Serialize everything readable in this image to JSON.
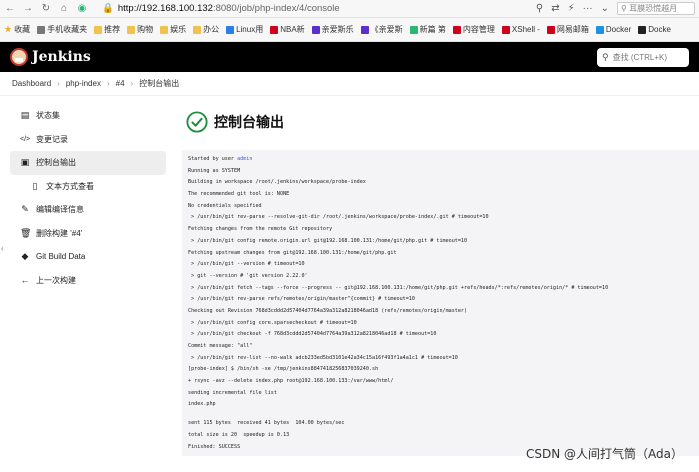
{
  "browser": {
    "url_host": "http://192.168.100.132",
    "url_path": ":8080/job/php-index/4/console",
    "search_placeholder": "耳膜恐慌越月",
    "bookmarks": [
      {
        "label": "收藏",
        "icon": "star-icon",
        "color": "#f5a623"
      },
      {
        "label": "手机收藏夹",
        "icon": "phone-icon",
        "color": "#777777"
      },
      {
        "label": "推荐",
        "icon": "folder-icon",
        "color": "#f2c14e"
      },
      {
        "label": "购物",
        "icon": "folder-icon",
        "color": "#f2c14e"
      },
      {
        "label": "娱乐",
        "icon": "folder-icon",
        "color": "#f2c14e"
      },
      {
        "label": "办公",
        "icon": "folder-icon",
        "color": "#f2c14e"
      },
      {
        "label": "Linux用",
        "icon": "site-icon",
        "color": "#2b7de9"
      },
      {
        "label": "NBA新",
        "icon": "site-icon",
        "color": "#d0021b"
      },
      {
        "label": "亲爱斯乐",
        "icon": "site-icon",
        "color": "#5b2fc9"
      },
      {
        "label": "《亲爱斯",
        "icon": "site-icon",
        "color": "#5b2fc9"
      },
      {
        "label": "新篇 第",
        "icon": "site-icon",
        "color": "#2bb673"
      },
      {
        "label": "内容管理",
        "icon": "site-icon",
        "color": "#d0021b"
      },
      {
        "label": "XShell -",
        "icon": "site-icon",
        "color": "#d0021b"
      },
      {
        "label": "网易邮箱",
        "icon": "site-icon",
        "color": "#d0021b"
      },
      {
        "label": "Docker",
        "icon": "docker-icon",
        "color": "#1d91e6"
      },
      {
        "label": "Docke",
        "icon": "github-icon",
        "color": "#222222"
      }
    ]
  },
  "header": {
    "title": "Jenkins",
    "search_placeholder": "查找 (CTRL+K)"
  },
  "breadcrumb": [
    "Dashboard",
    "php-index",
    "#4",
    "控制台输出"
  ],
  "sidebar": {
    "items": [
      {
        "label": "状态集",
        "icon": "status-icon",
        "glyph": "🗐"
      },
      {
        "label": "变更记录",
        "icon": "code-icon",
        "glyph": "</>"
      },
      {
        "label": "控制台输出",
        "icon": "terminal-icon",
        "glyph": "▣"
      },
      {
        "label": "文本方式查看",
        "icon": "document-icon",
        "glyph": "🗎"
      },
      {
        "label": "编辑编译信息",
        "icon": "edit-icon",
        "glyph": "✎"
      },
      {
        "label": "删除构建 '#4'",
        "icon": "trash-icon",
        "glyph": "🗑"
      },
      {
        "label": "Git Build Data",
        "icon": "git-icon",
        "glyph": "◆"
      },
      {
        "label": "上一次构建",
        "icon": "arrow-left-icon",
        "glyph": "←"
      }
    ]
  },
  "content": {
    "title": "控制台输出",
    "console_lines": [
      "Started by user ",
      "Running as SYSTEM",
      "Building in workspace /root/.jenkins/workspace/probe-index",
      "The recommended git tool is: NONE",
      "No credentials specified",
      " > /usr/bin/git rev-parse --resolve-git-dir /root/.jenkins/workspace/probe-index/.git # timeout=10",
      "Fetching changes from the remote Git repository",
      " > /usr/bin/git config remote.origin.url git@192.168.100.131:/home/git/php.git # timeout=10",
      "Fetching upstream changes from git@192.168.100.131:/home/git/php.git",
      " > /usr/bin/git --version # timeout=10",
      " > git --version # 'git version 2.22.0'",
      " > /usr/bin/git fetch --tags --force --progress -- git@192.168.100.131:/home/git/php.git +refs/heads/*:refs/remotes/origin/* # timeout=10",
      " > /usr/bin/git rev-parse refs/remotes/origin/master^{commit} # timeout=10",
      "Checking out Revision 768d3cddd2d57404d7764a39a312a8218046ad18 (refs/remotes/origin/master)",
      " > /usr/bin/git config core.sparsecheckout # timeout=10",
      " > /usr/bin/git checkout -f 768d3cddd2d57404d7764a39a312a8218046ad18 # timeout=10",
      "Commit message: \"all\"",
      " > /usr/bin/git rev-list --no-walk adcb233ed5bd3101e42a34c15a16f493f1a4a1c1 # timeout=10",
      "[probe-index] $ /bin/sh -xe /tmp/jenkins8847418256837039240.sh",
      "+ rsync -avz --delete index.php root@192.168.100.133:/var/www/html/",
      "sending incremental file list",
      "index.php",
      "",
      "sent 115 bytes  received 41 bytes  104.00 bytes/sec",
      "total size is 20  speedup is 0.13",
      "Finished: SUCCESS"
    ],
    "started_by_user": "admin"
  },
  "watermark": "CSDN @人间打气筒（Ada）",
  "colors": {
    "header_bg": "#000000",
    "success": "#1e8e3e",
    "link": "#3b5bdb",
    "console_bg": "#f4f4f6"
  }
}
